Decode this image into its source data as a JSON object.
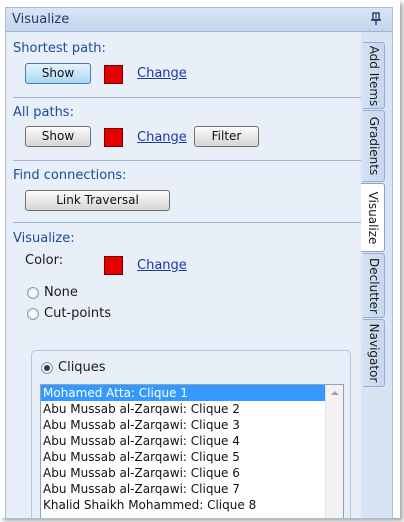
{
  "panel": {
    "title": "Visualize",
    "pin_icon": "pin-icon"
  },
  "shortest_path": {
    "label": "Shortest path:",
    "show_label": "Show",
    "color": "#e50000",
    "change_label": "Change"
  },
  "all_paths": {
    "label": "All paths:",
    "show_label": "Show",
    "color": "#e50000",
    "change_label": "Change",
    "filter_label": "Filter"
  },
  "find_connections": {
    "label": "Find connections:",
    "link_traversal_label": "Link Traversal"
  },
  "visualize": {
    "label": "Visualize:",
    "color_label": "Color:",
    "color": "#e50000",
    "change_label": "Change",
    "options": [
      {
        "label": "None",
        "selected": false
      },
      {
        "label": "Cut-points",
        "selected": false
      },
      {
        "label": "Cliques",
        "selected": true
      }
    ]
  },
  "cliques": {
    "items": [
      {
        "label": "Mohamed Atta: Clique 1",
        "selected": true
      },
      {
        "label": "Abu Mussab al-Zarqawi: Clique 2",
        "selected": false
      },
      {
        "label": "Abu Mussab al-Zarqawi: Clique 3",
        "selected": false
      },
      {
        "label": "Abu Mussab al-Zarqawi: Clique 4",
        "selected": false
      },
      {
        "label": "Abu Mussab al-Zarqawi: Clique 5",
        "selected": false
      },
      {
        "label": "Abu Mussab al-Zarqawi: Clique 6",
        "selected": false
      },
      {
        "label": "Abu Mussab al-Zarqawi: Clique 7",
        "selected": false
      },
      {
        "label": "Khalid Shaikh Mohammed: Clique 8",
        "selected": false
      }
    ]
  },
  "tabs": [
    {
      "label": "Add Items",
      "active": false
    },
    {
      "label": "Gradients",
      "active": false
    },
    {
      "label": "Visualize",
      "active": true
    },
    {
      "label": "Declutter",
      "active": false
    },
    {
      "label": "Navigator",
      "active": false
    }
  ]
}
